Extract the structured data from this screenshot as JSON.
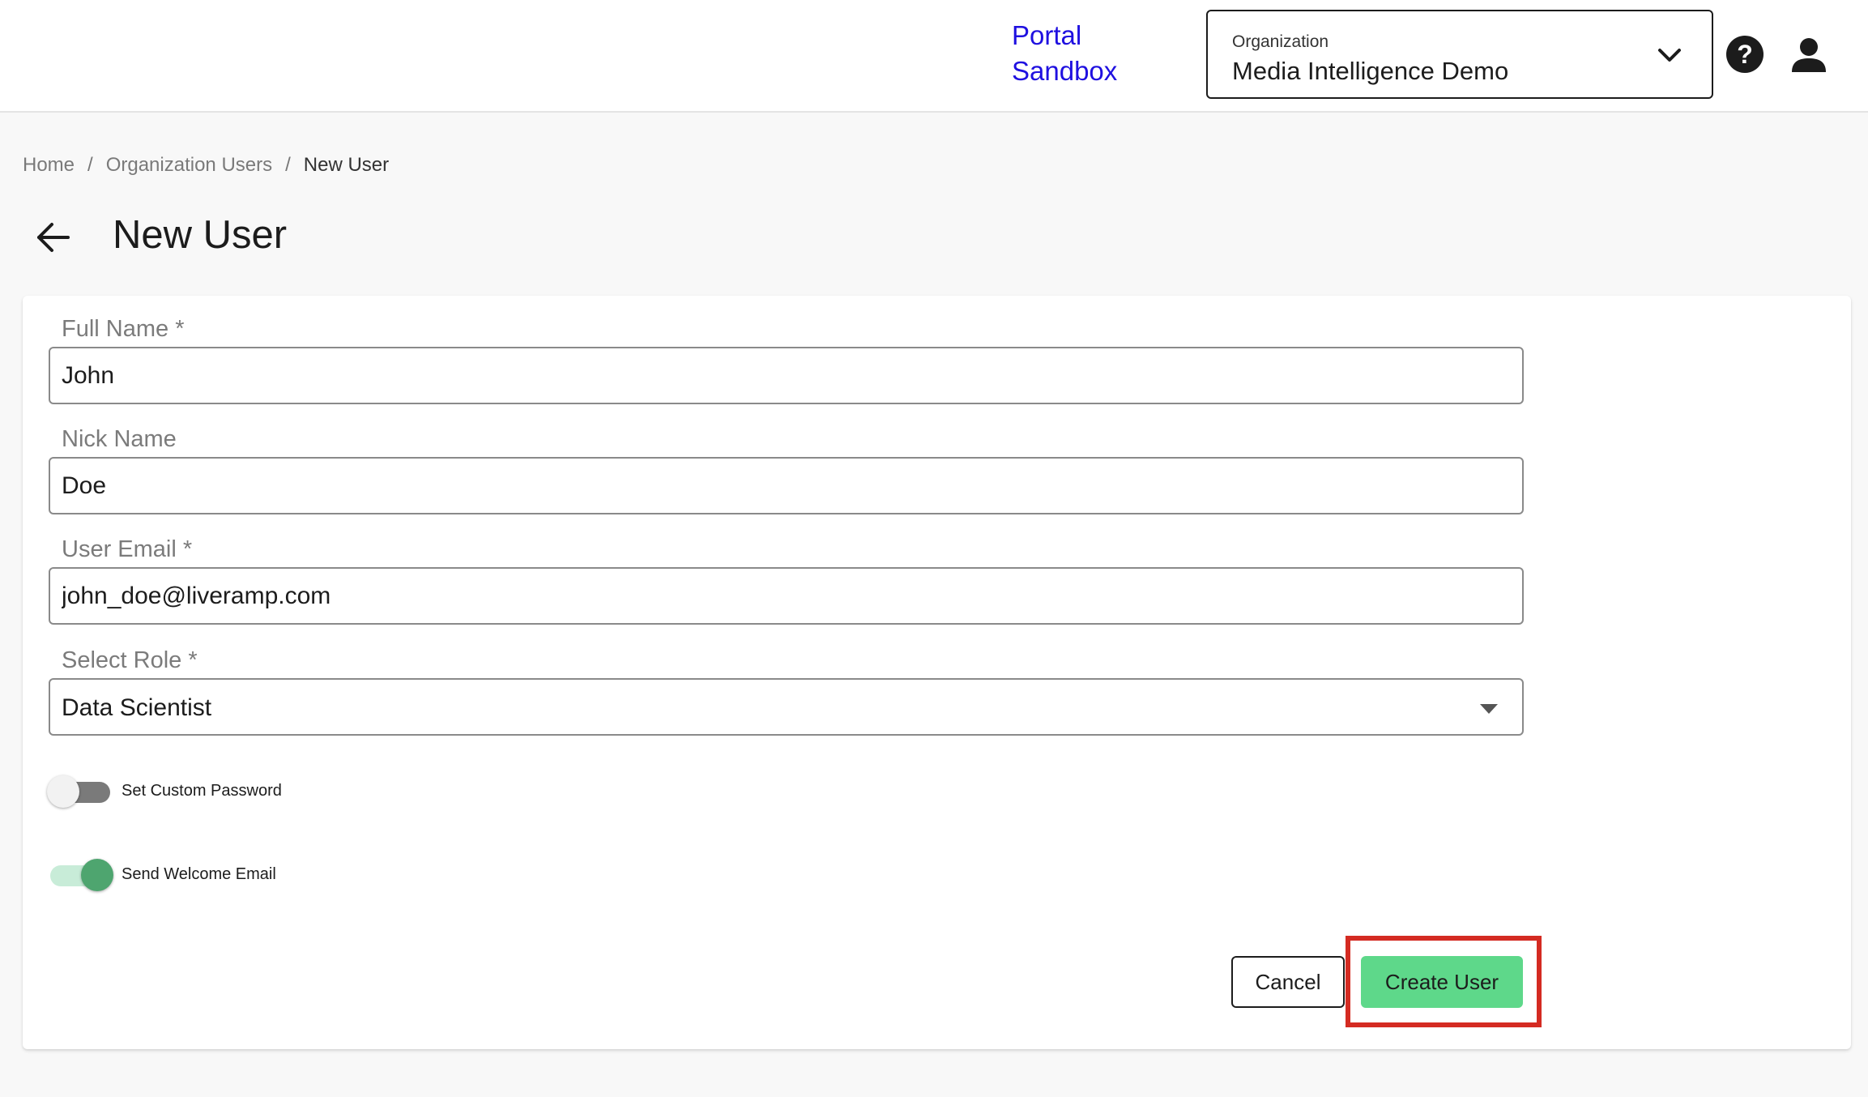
{
  "header": {
    "brand_line1": "Portal",
    "brand_line2": "Sandbox",
    "organization": {
      "label": "Organization",
      "value": "Media Intelligence Demo"
    },
    "icons": [
      "help-icon",
      "user-account-icon",
      "chevron-down-icon"
    ],
    "brand_color": "#1f10e0"
  },
  "breadcrumb": {
    "items": [
      "Home",
      "Organization Users",
      "New User"
    ],
    "separator": "/"
  },
  "page": {
    "title": "New User",
    "back_icon": "arrow-left-icon"
  },
  "form": {
    "full_name": {
      "label": "Full Name *",
      "value": "John"
    },
    "nick_name": {
      "label": "Nick Name",
      "value": "Doe"
    },
    "user_email": {
      "label": "User Email *",
      "value": "john_doe@liveramp.com"
    },
    "role": {
      "label": "Select Role *",
      "value": "Data Scientist"
    },
    "custom_password": {
      "label": "Set Custom Password",
      "enabled": false
    },
    "welcome_email": {
      "label": "Send Welcome Email",
      "enabled": true
    }
  },
  "actions": {
    "cancel_label": "Cancel",
    "create_label": "Create User",
    "create_color": "#5ed88a",
    "highlight_color": "#d42b22"
  }
}
